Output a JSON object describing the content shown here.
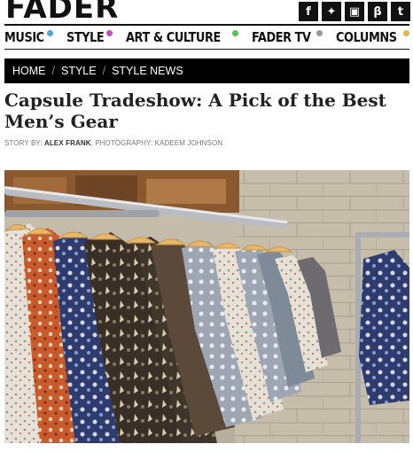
{
  "site": {
    "logo": "FADER"
  },
  "social": [
    {
      "name": "facebook",
      "glyph": "f"
    },
    {
      "name": "twitter",
      "glyph": "✦"
    },
    {
      "name": "instagram",
      "glyph": "▣"
    },
    {
      "name": "tumblr-alt",
      "glyph": "β"
    },
    {
      "name": "tumblr",
      "glyph": "t"
    }
  ],
  "nav": [
    {
      "label": "MUSIC",
      "color": "#4aa8d8"
    },
    {
      "label": "STYLE",
      "color": "#c34fb3"
    },
    {
      "label": "ART & CULTURE",
      "color": "#57c05a"
    },
    {
      "label": "FADER TV",
      "color": "#9a9a9a"
    },
    {
      "label": "COLUMNS",
      "color": "#e8b44c"
    }
  ],
  "breadcrumb": [
    "HOME",
    "STYLE",
    "STYLE NEWS"
  ],
  "article": {
    "title": "Capsule Tradeshow: A Pick of the Best Men’s Gear",
    "byline_prefix": "STORY BY:",
    "author": "ALEX FRANK",
    "photo_prefix": ", PHOTOGRAPHY:",
    "photographer": "KADEEM JOHNSON"
  }
}
